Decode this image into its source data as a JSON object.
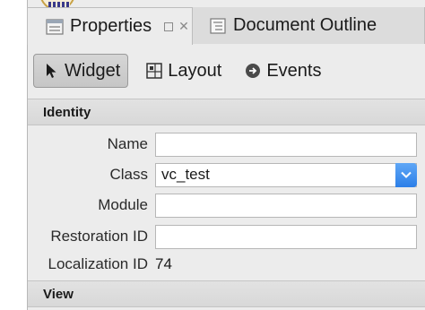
{
  "tabs": [
    {
      "label": "Properties",
      "icon": "properties-icon",
      "active": true
    },
    {
      "label": "Document Outline",
      "icon": "document-outline-icon",
      "active": false
    }
  ],
  "subtabs": [
    {
      "label": "Widget",
      "icon": "pointer-icon",
      "selected": true
    },
    {
      "label": "Layout",
      "icon": "layout-icon",
      "selected": false
    },
    {
      "label": "Events",
      "icon": "events-icon",
      "selected": false
    }
  ],
  "identity": {
    "header": "Identity",
    "name_label": "Name",
    "name_value": "",
    "class_label": "Class",
    "class_value": "vc_test",
    "module_label": "Module",
    "module_value": "",
    "restoration_label": "Restoration ID",
    "restoration_value": "",
    "localization_label": "Localization ID",
    "localization_value": "74"
  },
  "view": {
    "header": "View"
  },
  "colors": {
    "accent": "#2c7fe8",
    "panel": "#ececec"
  }
}
